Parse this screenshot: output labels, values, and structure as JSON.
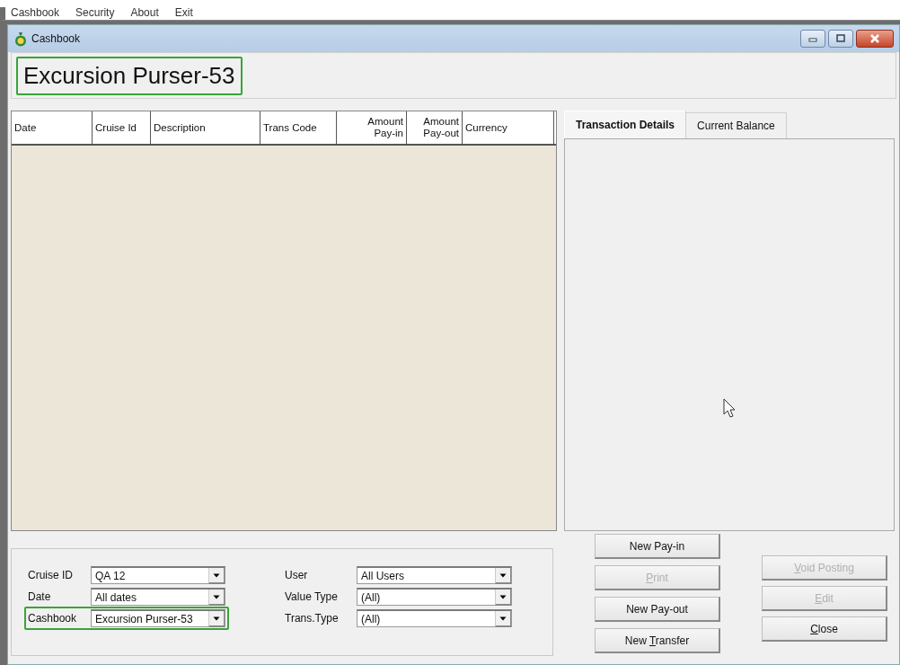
{
  "menu": [
    {
      "label": "Cashbook"
    },
    {
      "label": "Security"
    },
    {
      "label": "About"
    },
    {
      "label": "Exit"
    }
  ],
  "window": {
    "title": "Cashbook"
  },
  "heading": {
    "text": "Excursion Purser-53",
    "highlighted": true
  },
  "table": {
    "columns": [
      {
        "label": "Date"
      },
      {
        "label": "Cruise Id"
      },
      {
        "label": "Description"
      },
      {
        "label": "Trans Code"
      },
      {
        "label": "Amount\nPay-in"
      },
      {
        "label": "Amount\nPay-out"
      },
      {
        "label": "Currency"
      }
    ]
  },
  "tabs": [
    {
      "label": "Transaction Details",
      "selected": true
    },
    {
      "label": "Current Balance",
      "selected": false
    }
  ],
  "filters": [
    {
      "label": "Cruise ID",
      "value": "QA 12",
      "highlighted": false
    },
    {
      "label": "Date",
      "value": "All dates",
      "highlighted": false
    },
    {
      "label": "Cashbook",
      "value": "Excursion Purser-53",
      "highlighted": true
    },
    {
      "label": "User",
      "value": "All Users",
      "highlighted": false
    },
    {
      "label": "Value Type",
      "value": "(All)",
      "highlighted": false
    },
    {
      "label": "Trans.Type",
      "value": "(All)",
      "highlighted": false
    }
  ],
  "buttons": [
    {
      "label": "New Pay-in",
      "disabled": false
    },
    {
      "label": "Print",
      "disabled": true
    },
    {
      "label": "New Pay-out",
      "disabled": false
    },
    {
      "label": "New Transfer",
      "disabled": false
    },
    {
      "label": "Void Posting",
      "disabled": true
    },
    {
      "label": "Edit",
      "disabled": true
    },
    {
      "label": "Close",
      "disabled": false
    }
  ]
}
